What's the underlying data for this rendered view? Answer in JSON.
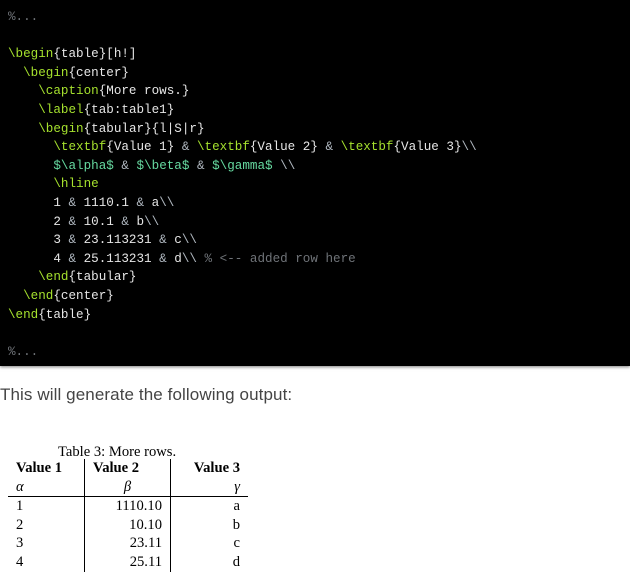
{
  "code": {
    "lines": [
      [
        {
          "t": "%...",
          "c": "comment"
        }
      ],
      [],
      [
        {
          "t": "\\begin",
          "c": "cmd"
        },
        {
          "t": "{table}[h!]",
          "c": "text"
        }
      ],
      [
        {
          "t": "  "
        },
        {
          "t": "\\begin",
          "c": "cmd"
        },
        {
          "t": "{center}",
          "c": "text"
        }
      ],
      [
        {
          "t": "    "
        },
        {
          "t": "\\caption",
          "c": "cmd"
        },
        {
          "t": "{More rows.}",
          "c": "text"
        }
      ],
      [
        {
          "t": "    "
        },
        {
          "t": "\\label",
          "c": "cmd"
        },
        {
          "t": "{tab:table1}",
          "c": "text"
        }
      ],
      [
        {
          "t": "    "
        },
        {
          "t": "\\begin",
          "c": "cmd"
        },
        {
          "t": "{tabular}{l|S|r}",
          "c": "text"
        }
      ],
      [
        {
          "t": "      "
        },
        {
          "t": "\\textbf",
          "c": "cmd"
        },
        {
          "t": "{Value 1} ",
          "c": "text"
        },
        {
          "t": "&",
          "c": "op"
        },
        {
          "t": " "
        },
        {
          "t": "\\textbf",
          "c": "cmd"
        },
        {
          "t": "{Value 2} ",
          "c": "text"
        },
        {
          "t": "&",
          "c": "op"
        },
        {
          "t": " "
        },
        {
          "t": "\\textbf",
          "c": "cmd"
        },
        {
          "t": "{Value 3}",
          "c": "text"
        },
        {
          "t": "\\\\",
          "c": "op"
        }
      ],
      [
        {
          "t": "      "
        },
        {
          "t": "$\\alpha$",
          "c": "math"
        },
        {
          "t": " "
        },
        {
          "t": "&",
          "c": "op"
        },
        {
          "t": " "
        },
        {
          "t": "$\\beta$",
          "c": "math"
        },
        {
          "t": " "
        },
        {
          "t": "&",
          "c": "op"
        },
        {
          "t": " "
        },
        {
          "t": "$\\gamma$",
          "c": "math"
        },
        {
          "t": " "
        },
        {
          "t": "\\\\",
          "c": "op"
        }
      ],
      [
        {
          "t": "      "
        },
        {
          "t": "\\hline",
          "c": "cmd"
        }
      ],
      [
        {
          "t": "      1 ",
          "c": "text"
        },
        {
          "t": "&",
          "c": "op"
        },
        {
          "t": " 1110.1 ",
          "c": "text"
        },
        {
          "t": "&",
          "c": "op"
        },
        {
          "t": " a",
          "c": "text"
        },
        {
          "t": "\\\\",
          "c": "op"
        }
      ],
      [
        {
          "t": "      2 ",
          "c": "text"
        },
        {
          "t": "&",
          "c": "op"
        },
        {
          "t": " 10.1 ",
          "c": "text"
        },
        {
          "t": "&",
          "c": "op"
        },
        {
          "t": " b",
          "c": "text"
        },
        {
          "t": "\\\\",
          "c": "op"
        }
      ],
      [
        {
          "t": "      3 ",
          "c": "text"
        },
        {
          "t": "&",
          "c": "op"
        },
        {
          "t": " 23.113231 ",
          "c": "text"
        },
        {
          "t": "&",
          "c": "op"
        },
        {
          "t": " c",
          "c": "text"
        },
        {
          "t": "\\\\",
          "c": "op"
        }
      ],
      [
        {
          "t": "      4 ",
          "c": "text"
        },
        {
          "t": "&",
          "c": "op"
        },
        {
          "t": " 25.113231 ",
          "c": "text"
        },
        {
          "t": "&",
          "c": "op"
        },
        {
          "t": " d",
          "c": "text"
        },
        {
          "t": "\\\\",
          "c": "op"
        },
        {
          "t": " "
        },
        {
          "t": "% <-- added row here",
          "c": "comment"
        }
      ],
      [
        {
          "t": "    "
        },
        {
          "t": "\\end",
          "c": "cmd"
        },
        {
          "t": "{tabular}",
          "c": "text"
        }
      ],
      [
        {
          "t": "  "
        },
        {
          "t": "\\end",
          "c": "cmd"
        },
        {
          "t": "{center}",
          "c": "text"
        }
      ],
      [
        {
          "t": "\\end",
          "c": "cmd"
        },
        {
          "t": "{table}",
          "c": "text"
        }
      ],
      [],
      [
        {
          "t": "%...",
          "c": "comment"
        }
      ]
    ]
  },
  "prose": "This will generate the following output:",
  "output_table": {
    "caption": "Table 3:  More rows.",
    "header": [
      "Value 1",
      "Value 2",
      "Value 3"
    ],
    "greek": [
      "α",
      "β",
      "γ"
    ],
    "rows": [
      [
        "1",
        "1110.10",
        "a"
      ],
      [
        "2",
        "10.10",
        "b"
      ],
      [
        "3",
        "23.11",
        "c"
      ],
      [
        "4",
        "25.11",
        "d"
      ]
    ]
  }
}
